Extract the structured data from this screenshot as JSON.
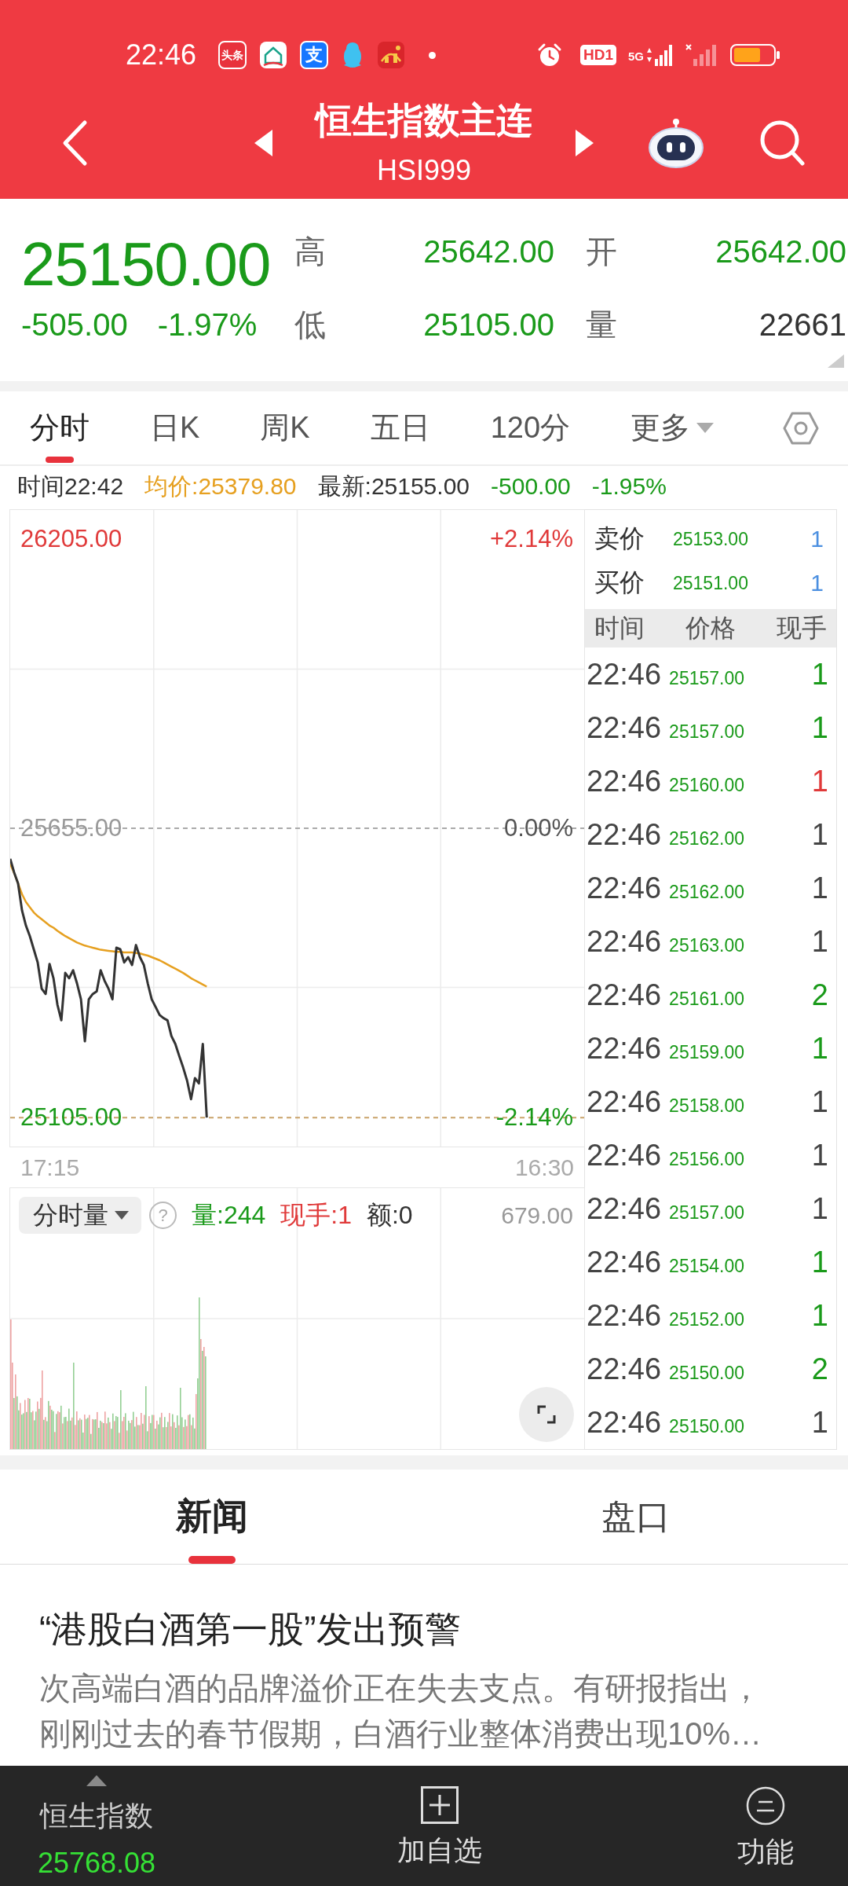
{
  "status_bar": {
    "time": "22:46",
    "notifications": [
      {
        "kind": "label",
        "text": "头条",
        "color": "#e8323c"
      },
      {
        "kind": "house"
      },
      {
        "kind": "label",
        "text": "支",
        "color": "#1677ff"
      },
      {
        "kind": "penguin"
      },
      {
        "kind": "gift"
      }
    ],
    "hd_label": "HD1",
    "network_label": "5G"
  },
  "header": {
    "title": "恒生指数主连",
    "code": "HSI999"
  },
  "quote": {
    "price": "25150.00",
    "change": "-505.00",
    "change_percent": "-1.97%",
    "falling": true,
    "stats": [
      {
        "label": "高",
        "value": "25642.00",
        "color": "#1a9a1a"
      },
      {
        "label": "开",
        "value": "25642.00",
        "color": "#1a9a1a"
      },
      {
        "label": "低",
        "value": "25105.00",
        "color": "#1a9a1a"
      },
      {
        "label": "量",
        "value": "22661",
        "color": "#333333"
      }
    ]
  },
  "period_tabs": [
    {
      "label": "分时",
      "selected": true,
      "kind": "tab"
    },
    {
      "label": "日K",
      "selected": false,
      "kind": "tab"
    },
    {
      "label": "周K",
      "selected": false,
      "kind": "tab"
    },
    {
      "label": "五日",
      "selected": false,
      "kind": "tab"
    },
    {
      "label": "120分",
      "selected": false,
      "kind": "tab"
    },
    {
      "label": "更多",
      "selected": false,
      "kind": "dropdown"
    }
  ],
  "info_line": [
    {
      "text": "时间22:42",
      "color": "#333333"
    },
    {
      "text": "均价:25379.80",
      "color": "#e6a020"
    },
    {
      "text": "最新:25155.00",
      "color": "#333333"
    },
    {
      "text": "-500.00",
      "color": "#1a9a1a"
    },
    {
      "text": "-1.95%",
      "color": "#1a9a1a"
    }
  ],
  "price_chart": {
    "chart_data": {
      "type": "line",
      "categories": [
        null,
        null,
        null,
        null,
        null,
        null,
        null,
        null,
        null,
        null,
        null,
        null,
        null,
        null,
        null,
        null,
        null,
        null,
        null,
        null,
        null,
        null,
        null,
        null,
        null,
        null,
        null,
        null,
        null,
        null,
        null,
        null,
        null,
        null,
        null,
        null,
        null,
        null,
        null,
        null,
        null,
        null,
        null,
        null,
        null,
        null,
        null,
        null,
        null,
        null,
        null,
        null,
        null,
        null,
        null,
        null,
        null,
        null,
        null,
        null,
        null,
        null,
        null,
        null,
        null,
        null,
        null,
        null,
        null,
        null,
        null,
        null,
        null,
        null,
        null,
        null,
        null,
        null,
        null,
        null,
        null,
        null,
        null,
        null,
        null,
        null,
        null,
        null,
        null,
        null,
        null,
        null,
        null,
        null,
        null,
        null,
        null,
        null,
        null,
        null,
        null,
        null,
        null,
        null,
        null,
        null,
        null,
        null,
        null,
        null,
        null,
        null,
        null,
        null,
        null,
        null,
        null,
        null,
        null,
        null,
        null,
        null,
        null,
        null,
        null,
        null,
        null,
        null,
        null,
        null,
        null,
        null,
        null,
        null,
        null,
        null,
        null,
        null,
        null,
        null,
        null,
        null,
        null,
        null,
        null,
        null,
        null
      ],
      "ylim": [
        25050,
        26260
      ],
      "yticks": [
        {
          "value": 26205,
          "label": "26205.00"
        },
        {
          "value": 25655,
          "label": "25655.00"
        },
        {
          "value": 25105,
          "label": "25105.00"
        }
      ],
      "ref_lines": [
        {
          "axis": "y",
          "value": 25655,
          "color": "#aaaaaa"
        },
        {
          "axis": "y",
          "value": 25105,
          "color": "#c9a36a"
        }
      ],
      "series": [
        {
          "color": "#333333",
          "values": [
            25597,
            25571,
            25550,
            25499,
            25470,
            25450,
            25425,
            25400,
            25350,
            25340,
            25397,
            25370,
            25320,
            25290,
            25380,
            25370,
            25385,
            25360,
            25330,
            25250,
            25330,
            25340,
            25345,
            25385,
            25365,
            25350,
            25330,
            25428,
            25425,
            25400,
            25410,
            25395,
            25433,
            25410,
            25395,
            25360,
            25330,
            25315,
            25300,
            25294,
            25290,
            25260,
            25245,
            25222,
            25200,
            25175,
            25140,
            25180,
            25170,
            25245,
            25105,
            null,
            null,
            null,
            null,
            null,
            null,
            null,
            null,
            null,
            null,
            null,
            null,
            null,
            null,
            null,
            null,
            null,
            null,
            null,
            null,
            null,
            null,
            null,
            null,
            null,
            null,
            null,
            null,
            null,
            null,
            null,
            null,
            null,
            null,
            null,
            null,
            null,
            null,
            null,
            null,
            null,
            null,
            null,
            null,
            null,
            null,
            null,
            null,
            null,
            null,
            null,
            null,
            null,
            null,
            null,
            null,
            null,
            null,
            null,
            null,
            null,
            null,
            null,
            null,
            null,
            null,
            null,
            null,
            null,
            null,
            null,
            null,
            null,
            null,
            null,
            null,
            null,
            null,
            null,
            null,
            null,
            null,
            null,
            null,
            null,
            null,
            null,
            null,
            null,
            null,
            null,
            null,
            null,
            null,
            null,
            null
          ]
        },
        {
          "color": "#e6a020",
          "values": [
            25587,
            25570,
            25550,
            25530,
            25515,
            25505,
            25495,
            25488,
            25482,
            25476,
            25470,
            25466,
            25460,
            25455,
            25450,
            25446,
            25442,
            25438,
            25435,
            25432,
            25430,
            25428,
            25426,
            25424,
            25423,
            25422,
            25421,
            25420,
            25420,
            25419,
            25419,
            25419,
            25418,
            25417,
            25415,
            25413,
            25410,
            25407,
            25404,
            25400,
            25396,
            25392,
            25388,
            25384,
            25380,
            25375,
            25370,
            25366,
            25362,
            25358,
            25354,
            null,
            null,
            null,
            null,
            null,
            null,
            null,
            null,
            null,
            null,
            null,
            null,
            null,
            null,
            null,
            null,
            null,
            null,
            null,
            null,
            null,
            null,
            null,
            null,
            null,
            null,
            null,
            null,
            null,
            null,
            null,
            null,
            null,
            null,
            null,
            null,
            null,
            null,
            null,
            null,
            null,
            null,
            null,
            null,
            null,
            null,
            null,
            null,
            null,
            null,
            null,
            null,
            null,
            null,
            null,
            null,
            null,
            null,
            null,
            null,
            null,
            null,
            null,
            null,
            null,
            null,
            null,
            null,
            null,
            null,
            null,
            null,
            null,
            null,
            null,
            null,
            null,
            null,
            null,
            null,
            null,
            null,
            null,
            null,
            null,
            null,
            null,
            null,
            null,
            null,
            null,
            null,
            null,
            null,
            null,
            null
          ]
        }
      ]
    },
    "percent_labels": [
      "+2.14%",
      "0.00%",
      "-2.14%"
    ],
    "time_labels": [
      "17:15",
      "16:30"
    ]
  },
  "volume_chart": {
    "selector": "分时量",
    "help": "?",
    "readings": [
      {
        "text": "量:244",
        "color": "#1a9a1a"
      },
      {
        "text": "现手:1",
        "color": "#e03a3a"
      },
      {
        "text": "额:0",
        "color": "#333333"
      }
    ],
    "max_label": "679.00"
  },
  "order_book": [
    {
      "label": "卖价",
      "price": "25153.00",
      "volume": "1"
    },
    {
      "label": "买价",
      "price": "25151.00",
      "volume": "1"
    }
  ],
  "trades": {
    "columns": [
      "时间",
      "价格",
      "现手"
    ],
    "price_falling": true,
    "rows": [
      {
        "time": "22:46",
        "price": "25157.00",
        "volume": "1",
        "color": "#1a9a1a"
      },
      {
        "time": "22:46",
        "price": "25157.00",
        "volume": "1",
        "color": "#1a9a1a"
      },
      {
        "time": "22:46",
        "price": "25160.00",
        "volume": "1",
        "color": "#e03a3a"
      },
      {
        "time": "22:46",
        "price": "25162.00",
        "volume": "1",
        "color": "#444444"
      },
      {
        "time": "22:46",
        "price": "25162.00",
        "volume": "1",
        "color": "#444444"
      },
      {
        "time": "22:46",
        "price": "25163.00",
        "volume": "1",
        "color": "#444444"
      },
      {
        "time": "22:46",
        "price": "25161.00",
        "volume": "2",
        "color": "#1a9a1a"
      },
      {
        "time": "22:46",
        "price": "25159.00",
        "volume": "1",
        "color": "#1a9a1a"
      },
      {
        "time": "22:46",
        "price": "25158.00",
        "volume": "1",
        "color": "#444444"
      },
      {
        "time": "22:46",
        "price": "25156.00",
        "volume": "1",
        "color": "#444444"
      },
      {
        "time": "22:46",
        "price": "25157.00",
        "volume": "1",
        "color": "#444444"
      },
      {
        "time": "22:46",
        "price": "25154.00",
        "volume": "1",
        "color": "#1a9a1a"
      },
      {
        "time": "22:46",
        "price": "25152.00",
        "volume": "1",
        "color": "#1a9a1a"
      },
      {
        "time": "22:46",
        "price": "25150.00",
        "volume": "2",
        "color": "#1a9a1a"
      },
      {
        "time": "22:46",
        "price": "25150.00",
        "volume": "1",
        "color": "#444444"
      }
    ]
  },
  "news_tabs": [
    {
      "label": "新闻",
      "selected": true
    },
    {
      "label": "盘口",
      "selected": false
    }
  ],
  "article": {
    "headline": "“港股白酒第一股”发出预警",
    "summary": "次高端白酒的品牌溢价正在失去支点。有研报指出，刚刚过去的春节假期，白酒行业整体消费出现10%…"
  },
  "bottom_bar": {
    "index_name": "恒生指数",
    "index_value": "25768.08",
    "index_falling": true,
    "actions": [
      {
        "kind": "add",
        "label": "加自选"
      },
      {
        "kind": "menu",
        "label": "功能"
      }
    ]
  }
}
